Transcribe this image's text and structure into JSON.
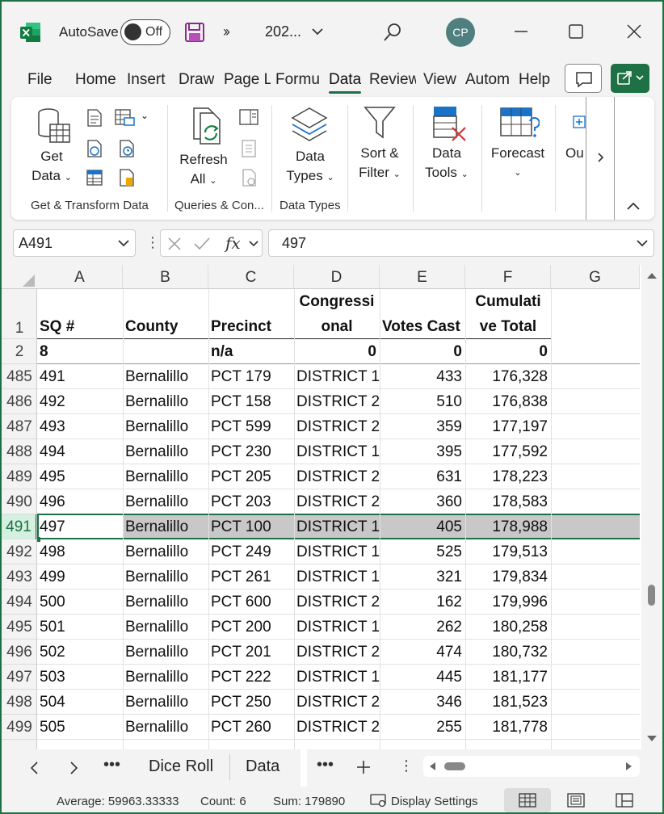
{
  "titlebar": {
    "autosave_label": "AutoSave",
    "autosave_state": "Off",
    "file_title": "202...",
    "avatar_initials": "CP"
  },
  "menu": {
    "tabs": [
      "File",
      "Home",
      "Insert",
      "Draw",
      "Page L",
      "Formu",
      "Data",
      "Review",
      "View",
      "Autom",
      "Help"
    ],
    "active_tab": "Data"
  },
  "ribbon": {
    "get_data": [
      "Get",
      "Data"
    ],
    "refresh_all": [
      "Refresh",
      "All"
    ],
    "data_types": [
      "Data",
      "Types"
    ],
    "sort_filter": [
      "Sort &",
      "Filter"
    ],
    "data_tools": [
      "Data",
      "Tools"
    ],
    "forecast": "Forecast",
    "outline": "Ou",
    "groups": [
      "Get & Transform Data",
      "Queries & Con...",
      "Data Types"
    ]
  },
  "formula_bar": {
    "name_box": "A491",
    "formula": "497"
  },
  "sheet": {
    "columns": [
      "A",
      "B",
      "C",
      "D",
      "E",
      "F",
      "G"
    ],
    "header_row": {
      "num": "1",
      "cells": [
        "SQ #",
        "County",
        "Precinct",
        "Congressi",
        "onal",
        "Votes Cast",
        "Cumulati",
        "ve Total"
      ]
    },
    "row2": {
      "num": "2",
      "cells": [
        "8",
        "",
        "n/a",
        "0",
        "0",
        "0"
      ]
    },
    "rows": [
      {
        "num": "485",
        "cells": [
          "491",
          "Bernalillo",
          "PCT 179",
          "DISTRICT 1",
          "433",
          "176,328"
        ]
      },
      {
        "num": "486",
        "cells": [
          "492",
          "Bernalillo",
          "PCT 158",
          "DISTRICT 2",
          "510",
          "176,838"
        ]
      },
      {
        "num": "487",
        "cells": [
          "493",
          "Bernalillo",
          "PCT 599",
          "DISTRICT 2",
          "359",
          "177,197"
        ]
      },
      {
        "num": "488",
        "cells": [
          "494",
          "Bernalillo",
          "PCT 230",
          "DISTRICT 1",
          "395",
          "177,592"
        ]
      },
      {
        "num": "489",
        "cells": [
          "495",
          "Bernalillo",
          "PCT 205",
          "DISTRICT 2",
          "631",
          "178,223"
        ]
      },
      {
        "num": "490",
        "cells": [
          "496",
          "Bernalillo",
          "PCT 203",
          "DISTRICT 2",
          "360",
          "178,583"
        ]
      },
      {
        "num": "491",
        "cells": [
          "497",
          "Bernalillo",
          "PCT 100",
          "DISTRICT 1",
          "405",
          "178,988"
        ]
      },
      {
        "num": "492",
        "cells": [
          "498",
          "Bernalillo",
          "PCT 249",
          "DISTRICT 1",
          "525",
          "179,513"
        ]
      },
      {
        "num": "493",
        "cells": [
          "499",
          "Bernalillo",
          "PCT 261",
          "DISTRICT 1",
          "321",
          "179,834"
        ]
      },
      {
        "num": "494",
        "cells": [
          "500",
          "Bernalillo",
          "PCT 600",
          "DISTRICT 2",
          "162",
          "179,996"
        ]
      },
      {
        "num": "495",
        "cells": [
          "501",
          "Bernalillo",
          "PCT 200",
          "DISTRICT 1",
          "262",
          "180,258"
        ]
      },
      {
        "num": "496",
        "cells": [
          "502",
          "Bernalillo",
          "PCT 201",
          "DISTRICT 2",
          "474",
          "180,732"
        ]
      },
      {
        "num": "497",
        "cells": [
          "503",
          "Bernalillo",
          "PCT 222",
          "DISTRICT 1",
          "445",
          "181,177"
        ]
      },
      {
        "num": "498",
        "cells": [
          "504",
          "Bernalillo",
          "PCT 250",
          "DISTRICT 2",
          "346",
          "181,523"
        ]
      },
      {
        "num": "499",
        "cells": [
          "505",
          "Bernalillo",
          "PCT 260",
          "DISTRICT 2",
          "255",
          "181,778"
        ]
      }
    ],
    "selected_row": "491"
  },
  "sheet_tabs": [
    "Dice Roll",
    "Data"
  ],
  "status": {
    "average": "Average: 59963.33333",
    "count": "Count: 6",
    "sum": "Sum: 179890",
    "display_settings": "Display Settings"
  },
  "colors": {
    "accent": "#1e7145",
    "selection": "#c8c8c8"
  }
}
